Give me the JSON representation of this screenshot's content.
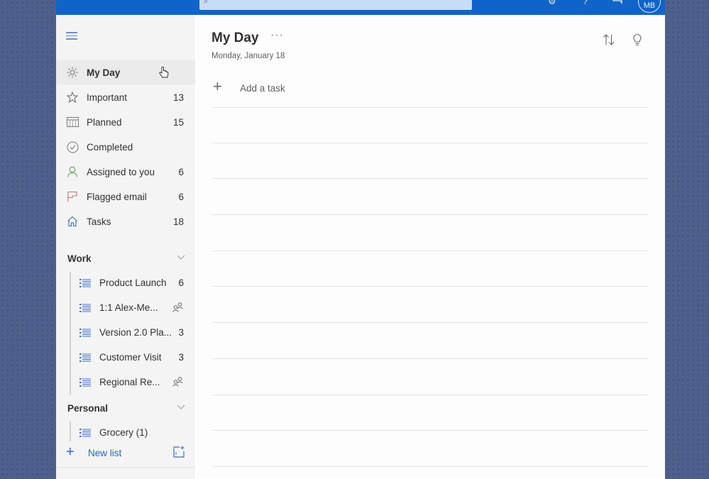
{
  "topbar": {
    "search_icon": "search-icon",
    "icons": [
      "settings-icon",
      "help-icon",
      "feedback-icon"
    ],
    "avatar_initials": "MB"
  },
  "sidebar": {
    "menu_icon": "hamburger-icon",
    "smart_lists": [
      {
        "label": "My Day",
        "count": "",
        "icon": "sun-icon",
        "selected": true
      },
      {
        "label": "Important",
        "count": "13",
        "icon": "star-icon"
      },
      {
        "label": "Planned",
        "count": "15",
        "icon": "calendar-icon"
      },
      {
        "label": "Completed",
        "count": "",
        "icon": "check-circle-icon"
      },
      {
        "label": "Assigned to you",
        "count": "6",
        "icon": "person-icon"
      },
      {
        "label": "Flagged email",
        "count": "6",
        "icon": "flag-icon"
      },
      {
        "label": "Tasks",
        "count": "18",
        "icon": "home-icon"
      }
    ],
    "groups": [
      {
        "label": "Work",
        "lists": [
          {
            "label": "Product Launch",
            "count": "6",
            "shared": false
          },
          {
            "label": "1:1 Alex-Me...",
            "count": "",
            "shared": true
          },
          {
            "label": "Version 2.0 Pla...",
            "count": "3",
            "shared": false
          },
          {
            "label": "Customer Visit",
            "count": "3",
            "shared": false
          },
          {
            "label": "Regional Re...",
            "count": "",
            "shared": true
          }
        ]
      },
      {
        "label": "Personal",
        "lists": [
          {
            "label": "Grocery (1)",
            "count": "",
            "shared": false
          }
        ]
      }
    ],
    "new_list_label": "New list"
  },
  "main": {
    "title": "My Day",
    "more_label": "···",
    "date": "Monday, January 18",
    "add_task_label": "Add a task",
    "toolbar": [
      "sort-icon",
      "lightbulb-icon"
    ]
  },
  "colors": {
    "accent": "#0f64c8",
    "link": "#2564cf",
    "sidebar_bg": "#f4f4f4",
    "selected_bg": "#ebebeb"
  }
}
